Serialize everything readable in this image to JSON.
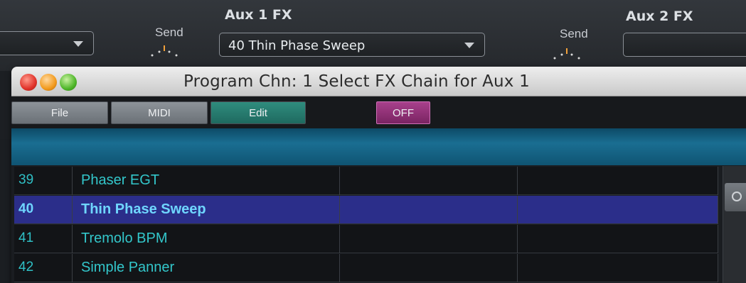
{
  "mixer": {
    "send_label": "Send",
    "aux1_title": "Aux 1 FX",
    "aux1_value": "40  Thin Phase Sweep",
    "aux2_title": "Aux 2 FX"
  },
  "window": {
    "title": "Program Chn: 1  Select FX Chain for Aux 1",
    "toolbar": {
      "file": "File",
      "midi": "MIDI",
      "edit": "Edit",
      "off": "OFF"
    }
  },
  "list": {
    "rows": [
      {
        "num": "39",
        "name": "Phaser EGT"
      },
      {
        "num": "40",
        "name": "Thin Phase Sweep"
      },
      {
        "num": "41",
        "name": "Tremolo BPM"
      },
      {
        "num": "42",
        "name": "Simple Panner"
      }
    ],
    "selected_index": 1
  },
  "colors": {
    "accent_blue": "#1a6e92",
    "selection": "#2b2e8a",
    "list_text": "#33c7cb",
    "edit_button": "#2f8c7e",
    "off_button": "#a8408c"
  }
}
